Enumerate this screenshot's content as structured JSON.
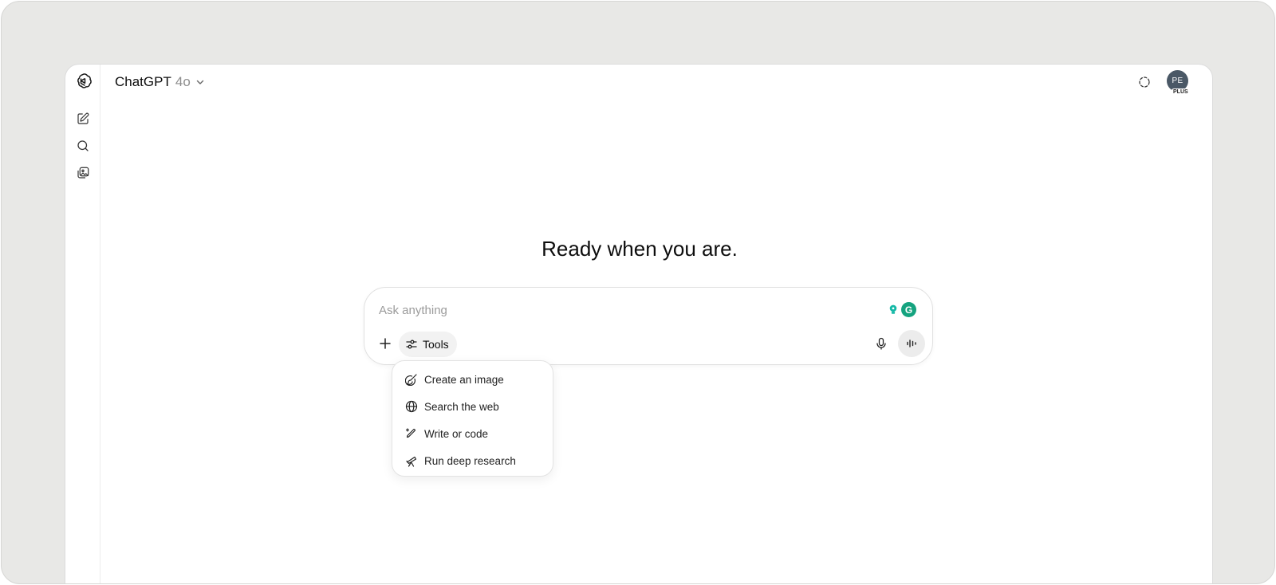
{
  "header": {
    "model_name": "ChatGPT",
    "model_version": "4o",
    "avatar_initials": "PE",
    "plan_badge": "PLUS"
  },
  "sidebar": {
    "items": [
      {
        "icon": "openai-logo-icon"
      },
      {
        "icon": "new-chat-icon"
      },
      {
        "icon": "search-icon"
      },
      {
        "icon": "library-icon"
      }
    ]
  },
  "main": {
    "headline": "Ready when you are."
  },
  "composer": {
    "placeholder": "Ask anything",
    "value": "",
    "tools_label": "Tools",
    "extension_grammarly": "G"
  },
  "tools_menu": {
    "items": [
      {
        "label": "Create an image",
        "icon": "image-brush-icon"
      },
      {
        "label": "Search the web",
        "icon": "globe-icon"
      },
      {
        "label": "Write or code",
        "icon": "pencil-sparkle-icon"
      },
      {
        "label": "Run deep research",
        "icon": "telescope-icon"
      }
    ]
  },
  "colors": {
    "frame": "#e8e8e6",
    "avatar": "#4a5866",
    "grammarly": "#15a37f",
    "hint": "#14b8a6"
  }
}
